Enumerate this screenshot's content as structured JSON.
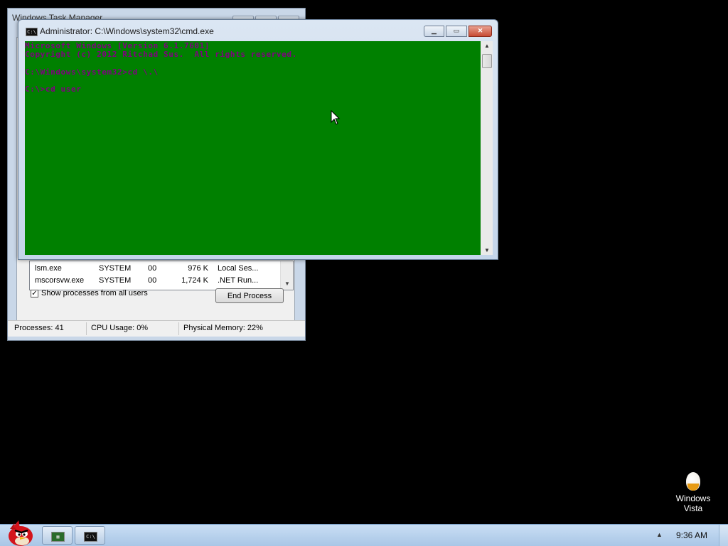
{
  "task_manager": {
    "title": "Windows Task Manager",
    "processes": [
      {
        "name": "lsm.exe",
        "user": "SYSTEM",
        "cpu": "00",
        "memory": "976 K",
        "description": "Local Ses..."
      },
      {
        "name": "mscorsvw.exe",
        "user": "SYSTEM",
        "cpu": "00",
        "memory": "1,724 K",
        "description": ".NET Run..."
      }
    ],
    "show_all_label": "Show processes from all users",
    "show_all_checked": true,
    "end_process_label": "End Process",
    "status": {
      "processes": "Processes: 41",
      "cpu": "CPU Usage: 0%",
      "memory": "Physical Memory: 22%"
    }
  },
  "cmd": {
    "title": "Administrator: C:\\Windows\\system32\\cmd.exe",
    "lines": [
      "Microsoft Windows [Version 6.1.7601]",
      "Copyright (c) 2012 Ritchad Sus.  All rights reserved.",
      "",
      "C:\\Windows\\system32>cd \\.\\",
      "",
      "C:\\>cd user"
    ],
    "colors": {
      "background": "#008000",
      "text": "#800080"
    }
  },
  "desktop": {
    "icon_label_1": "Windows",
    "icon_label_2": "Vista"
  },
  "taskbar": {
    "clock": "9:36 AM",
    "start_icon": "angry-bird-orb",
    "buttons": [
      "task-manager",
      "cmd"
    ]
  }
}
